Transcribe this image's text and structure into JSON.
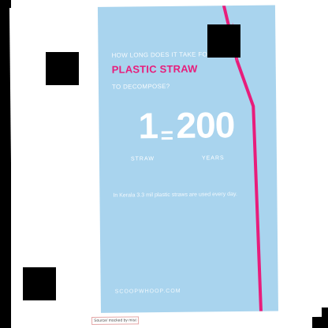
{
  "poster": {
    "question_line1": "HOW LONG DOES IT TAKE FOR A",
    "question_highlight": "PLASTIC STRAW",
    "question_line3": "TO DECOMPOSE?",
    "big_left": "1",
    "equals": "=",
    "big_right": "200",
    "unit_left": "STRAW",
    "unit_right": "YEARS",
    "stat": "In Kerala 3.3 mil plastic straws are used every day.",
    "source": "SCOOPWHOOP.COM",
    "colors": {
      "background": "#a9d4ee",
      "accent": "#e81d7b",
      "text": "#ffffff"
    }
  },
  "caption": "Source/ mocked by misc",
  "icons": {
    "straw": "straw-graphic"
  }
}
